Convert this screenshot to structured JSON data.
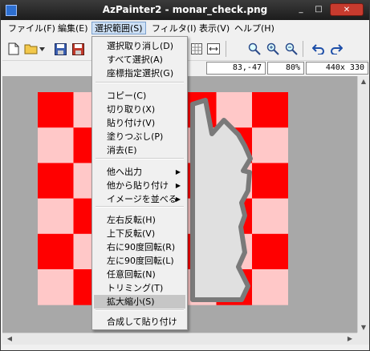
{
  "title": "AzPainter2 - monar_check.png",
  "window_controls": {
    "minimize": "_",
    "maximize": "□",
    "close": "✕"
  },
  "menubar": [
    {
      "label": "ファイル(F)",
      "active": false
    },
    {
      "label": "編集(E)",
      "active": false
    },
    {
      "label": "選択範囲(S)",
      "active": true
    },
    {
      "label": "フィルタ(I)",
      "active": false
    },
    {
      "label": "表示(V)",
      "active": false
    },
    {
      "label": "ヘルプ(H)",
      "active": false
    }
  ],
  "status": {
    "coords": "83,-47",
    "zoom": "80%",
    "size": "440x 330"
  },
  "dropdown": {
    "items": [
      {
        "label": "選択取り消し(D)"
      },
      {
        "label": "すべて選択(A)"
      },
      {
        "label": "座標指定選択(G)"
      },
      {
        "label": "コピー(C)"
      },
      {
        "label": "切り取り(X)"
      },
      {
        "label": "貼り付け(V)"
      },
      {
        "label": "塗りつぶし(P)"
      },
      {
        "label": "消去(E)"
      },
      {
        "label": "他へ出力",
        "submenu": "▶"
      },
      {
        "label": "他から貼り付け",
        "submenu": "▶"
      },
      {
        "label": "イメージを並べる",
        "submenu": "▶"
      },
      {
        "label": "左右反転(H)"
      },
      {
        "label": "上下反転(V)"
      },
      {
        "label": "右に90度回転(R)"
      },
      {
        "label": "左に90度回転(L)"
      },
      {
        "label": "任意回転(N)"
      },
      {
        "label": "トリミング(T)"
      },
      {
        "label": "拡大縮小(S)",
        "highlighted": true
      },
      {
        "label": "合成して貼り付け"
      }
    ]
  },
  "colors": {
    "checker_red": "#ff0000",
    "checker_pink": "#ffc8c8",
    "figure_fill": "#e0e0e0",
    "figure_outline": "#7a7a7a",
    "canvas_bg": "#a8a8a8"
  },
  "toolbar_icons": [
    "new-file-icon",
    "open-folder-icon",
    "dropdown-arrow-icon",
    "save-icon",
    "save-as-icon",
    "grid-icon",
    "fit-icon",
    "zoom-icon",
    "zoom-in-icon",
    "zoom-out-icon",
    "undo-icon",
    "redo-icon"
  ]
}
